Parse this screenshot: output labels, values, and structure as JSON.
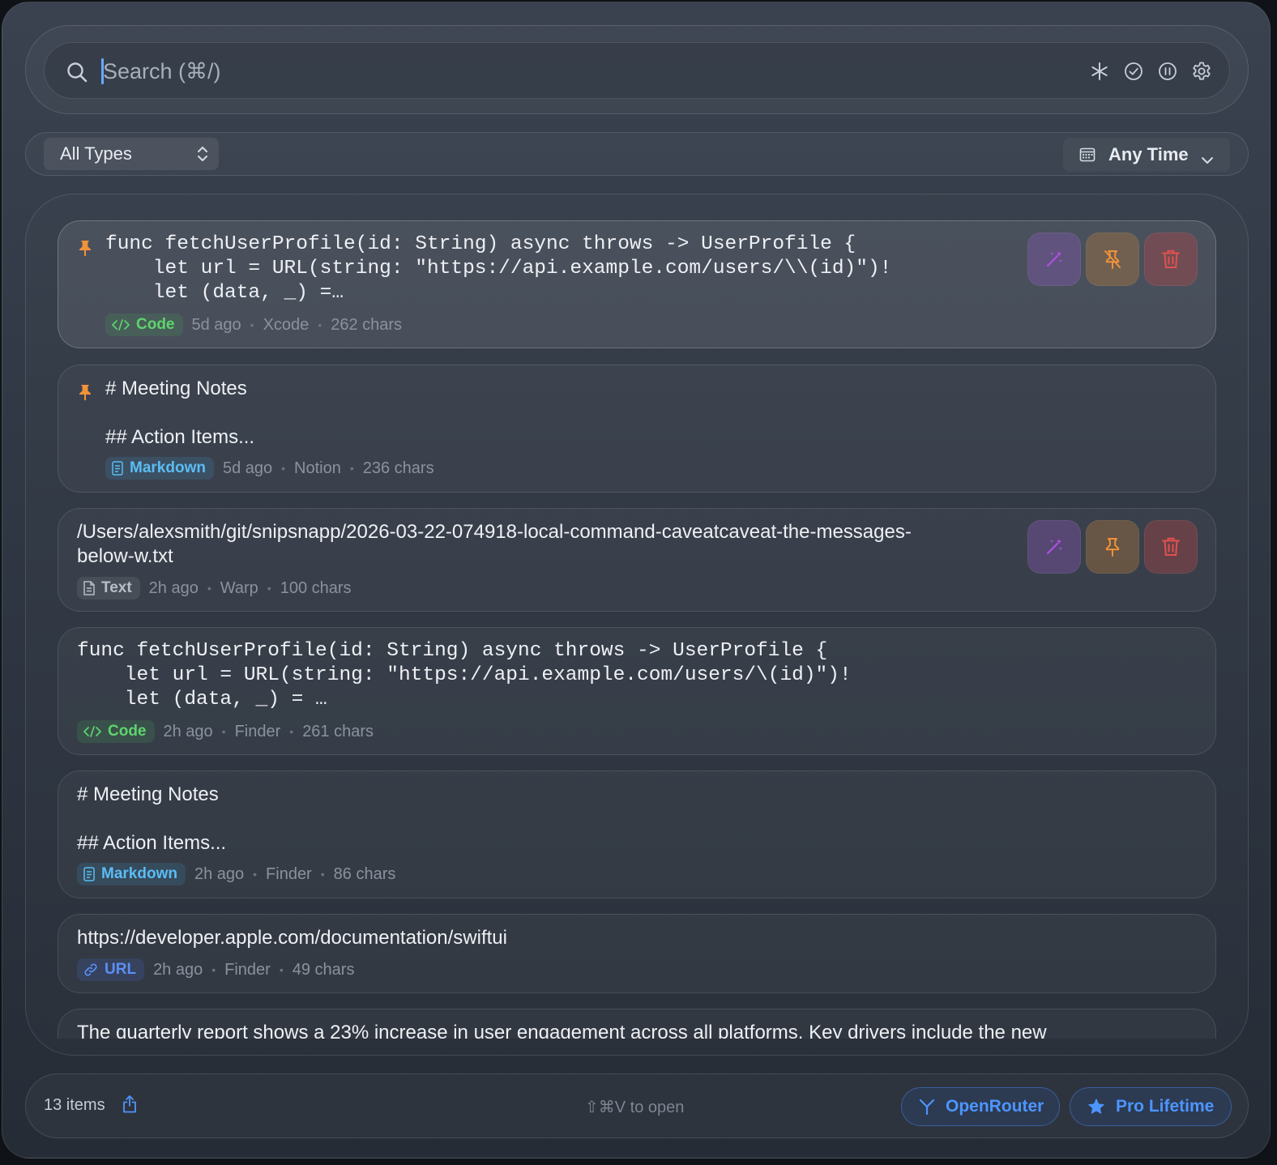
{
  "search": {
    "placeholder": "Search (⌘/)",
    "value": ""
  },
  "toolbar_icons": [
    "asterisk-icon",
    "check-circle-icon",
    "pause-circle-icon",
    "gear-icon"
  ],
  "filters": {
    "type_label": "All Types",
    "time_label": "Any Time"
  },
  "colors": {
    "accent_blue": "#4d95ff",
    "code_green": "#5fd36e",
    "markdown_cyan": "#5bbcf3",
    "url_blue": "#5b8ff5",
    "pin_orange": "#f0923a",
    "delete_red": "#e0524f",
    "ai_purple": "#b04fe6"
  },
  "clips": [
    {
      "pinned": true,
      "content": "func fetchUserProfile(id: String) async throws -> UserProfile {\n    let url = URL(string: \"https://api.example.com/users/\\\\(id)\")!\n    let (data, _) =…",
      "type": "Code",
      "age": "5d ago",
      "source": "Xcode",
      "size": "262 chars"
    },
    {
      "pinned": true,
      "content": "# Meeting Notes\n\n## Action Items...",
      "type": "Markdown",
      "age": "5d ago",
      "source": "Notion",
      "size": "236 chars"
    },
    {
      "pinned": false,
      "content": "/Users/alexsmith/git/snipsnapp/2026-03-22-074918-local-command-caveatcaveat-the-messages-\nbelow-w.txt",
      "type": "Text",
      "age": "2h ago",
      "source": "Warp",
      "size": "100 chars"
    },
    {
      "pinned": false,
      "content": "func fetchUserProfile(id: String) async throws -> UserProfile {\n    let url = URL(string: \"https://api.example.com/users/\\(id)\")!\n    let (data, _) = …",
      "type": "Code",
      "age": "2h ago",
      "source": "Finder",
      "size": "261 chars"
    },
    {
      "pinned": false,
      "content": "# Meeting Notes\n\n## Action Items...",
      "type": "Markdown",
      "age": "2h ago",
      "source": "Finder",
      "size": "86 chars"
    },
    {
      "pinned": false,
      "content": "https://developer.apple.com/documentation/swiftui",
      "type": "URL",
      "age": "2h ago",
      "source": "Finder",
      "size": "49 chars"
    },
    {
      "pinned": false,
      "content": "The quarterly report shows a 23% increase in user engagement across all platforms. Key drivers include the new"
    }
  ],
  "footer": {
    "item_count": "13 items",
    "hint": "⇧⌘V to open",
    "openrouter_label": "OpenRouter",
    "pro_label": "Pro Lifetime"
  }
}
